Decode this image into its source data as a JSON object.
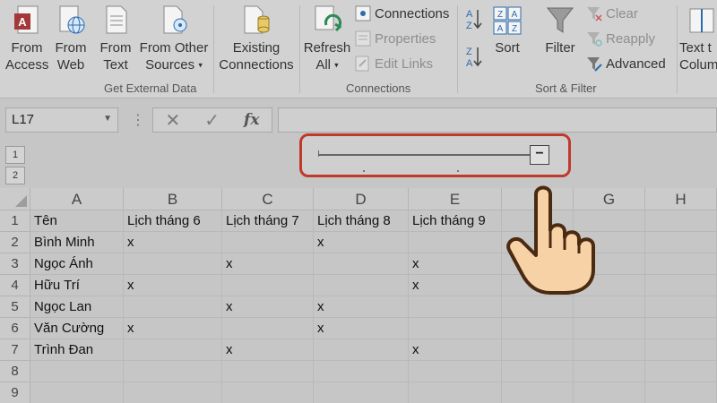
{
  "ribbon": {
    "get_external_data": {
      "label": "Get External Data",
      "from_access": [
        "From",
        "Access"
      ],
      "from_web": [
        "From",
        "Web"
      ],
      "from_text": [
        "From",
        "Text"
      ],
      "from_other": [
        "From Other",
        "Sources"
      ],
      "existing_connections": [
        "Existing",
        "Connections"
      ]
    },
    "connections": {
      "label": "Connections",
      "refresh_all": [
        "Refresh",
        "All"
      ],
      "connections": "Connections",
      "properties": "Properties",
      "edit_links": "Edit Links"
    },
    "sort_filter": {
      "label": "Sort & Filter",
      "sort": "Sort",
      "filter": "Filter",
      "clear": "Clear",
      "reapply": "Reapply",
      "advanced": "Advanced"
    },
    "data_tools": {
      "text_to_columns": [
        "Text t",
        "Colum"
      ]
    }
  },
  "formula_bar": {
    "name_box": "L17",
    "dots": "⋮",
    "cancel": "✕",
    "enter": "✓",
    "fx": "fx",
    "formula": ""
  },
  "outline": {
    "levels": [
      "1",
      "2"
    ],
    "collapse_symbol": "−"
  },
  "grid": {
    "columns": [
      "A",
      "B",
      "C",
      "D",
      "E",
      "",
      "G",
      "H"
    ],
    "rows": [
      "1",
      "2",
      "3",
      "4",
      "5",
      "6",
      "7",
      "8",
      "9"
    ],
    "cells": [
      [
        "Tên",
        "Lịch tháng 6",
        "Lịch tháng 7",
        "Lịch tháng 8",
        "Lịch tháng 9",
        "",
        "",
        ""
      ],
      [
        "Bình Minh",
        "x",
        "",
        "x",
        "",
        "",
        "",
        ""
      ],
      [
        "Ngọc Ánh",
        "",
        "x",
        "",
        "x",
        "",
        "",
        ""
      ],
      [
        "Hữu Trí",
        "x",
        "",
        "",
        "x",
        "",
        "",
        ""
      ],
      [
        "Ngọc Lan",
        "",
        "x",
        "x",
        "",
        "",
        "",
        ""
      ],
      [
        "Văn Cường",
        "x",
        "",
        "x",
        "",
        "",
        "",
        ""
      ],
      [
        "Trình Đan",
        "",
        "x",
        "",
        "x",
        "",
        "",
        ""
      ],
      [
        "",
        "",
        "",
        "",
        "",
        "",
        "",
        ""
      ],
      [
        "",
        "",
        "",
        "",
        "",
        "",
        "",
        ""
      ]
    ]
  },
  "colors": {
    "callout_border": "#c0392b",
    "hand_fill": "#f6d2a6",
    "hand_stroke": "#4a2a10"
  }
}
